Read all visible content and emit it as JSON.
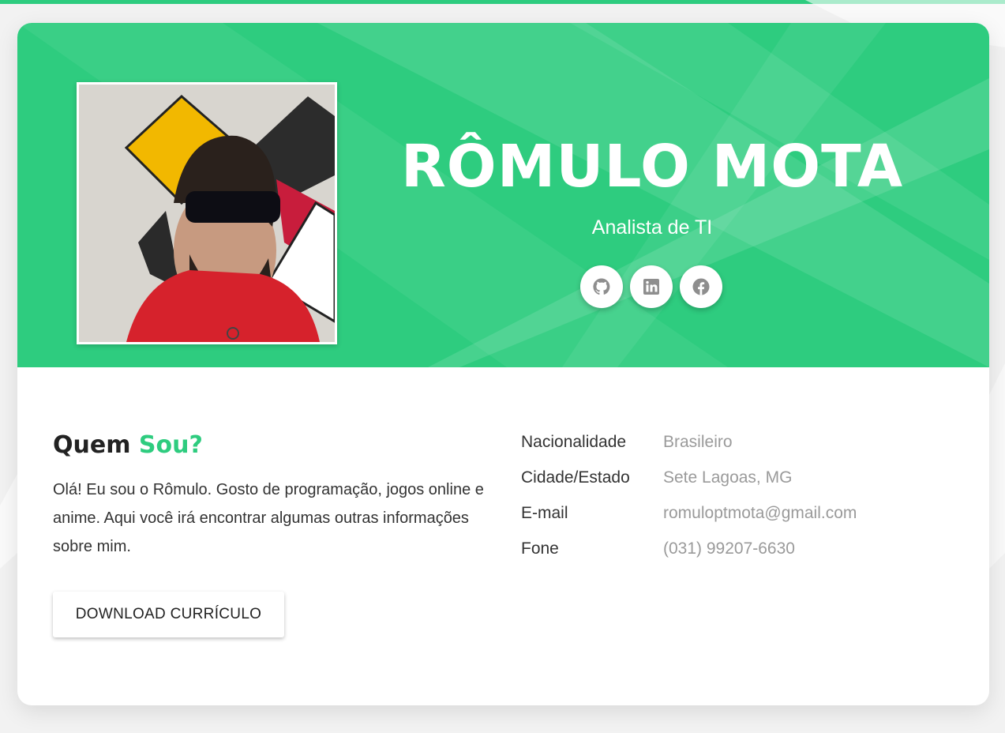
{
  "profile": {
    "name": "RÔMULO MOTA",
    "role": "Analista de TI"
  },
  "social": [
    {
      "icon": "github-icon"
    },
    {
      "icon": "linkedin-icon"
    },
    {
      "icon": "facebook-icon"
    }
  ],
  "about": {
    "title_part1": "Quem",
    "title_part2": "Sou?",
    "text": "Olá! Eu sou o Rômulo. Gosto de programação, jogos online e anime. Aqui você irá encontrar algumas outras informações sobre mim.",
    "download_label": "DOWNLOAD CURRÍCULO"
  },
  "info": {
    "rows": [
      {
        "label": "Nacionalidade",
        "value": "Brasileiro"
      },
      {
        "label": "Cidade/Estado",
        "value": "Sete Lagoas, MG"
      },
      {
        "label": "E-mail",
        "value": "romuloptmota@gmail.com"
      },
      {
        "label": "Fone",
        "value": "(031) 99207-6630"
      }
    ]
  },
  "colors": {
    "accent": "#2ecc7f",
    "icon": "#8e8e8e",
    "background": "#f2f2f2"
  }
}
